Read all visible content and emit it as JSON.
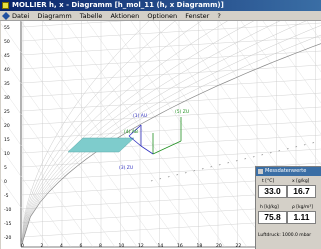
{
  "window": {
    "title": "MOLLIER h, x - Diagramm",
    "doc_title": "[h_mol_11 (h, x Diagramm)]"
  },
  "menu": [
    "Datei",
    "Diagramm",
    "Tabelle",
    "Aktionen",
    "Optionen",
    "Fenster",
    "?"
  ],
  "chart": {
    "y_ticks": [
      "55",
      "50",
      "45",
      "40",
      "35",
      "30",
      "25",
      "20",
      "15",
      "10",
      "5",
      "0",
      "-5",
      "-10",
      "-15",
      "-20"
    ],
    "x_ticks": [
      "0",
      "2",
      "4",
      "6",
      "8",
      "10",
      "12",
      "14",
      "16",
      "18",
      "20",
      "22",
      "24",
      "26",
      "28",
      "30"
    ],
    "points": [
      {
        "label": "(1) AU",
        "color": "#3030c0"
      },
      {
        "label": "(5) ZU",
        "color": "#209020"
      },
      {
        "label": "(4) AB",
        "color": "#209020"
      },
      {
        "label": "(3) ZU",
        "color": "#3030c0"
      }
    ]
  },
  "measure_window": {
    "title": "Messdatenwerte",
    "fields": [
      {
        "label": "t [°C]",
        "value": "33.0"
      },
      {
        "label": "x [g/kg]",
        "value": "16.7"
      },
      {
        "label": "h [kJ/kg]",
        "value": "75.8"
      },
      {
        "label": "ρ [kg/m³]",
        "value": "1.11"
      }
    ],
    "footer": "Luftdruck: 1000.0 mbar"
  },
  "colors": {
    "title_bar": "#0a246a",
    "chart_bg": "#ffffff",
    "grid": "#c8c8c8",
    "process_area": "#7ecccc",
    "measure_title": "#3a6ea5"
  }
}
